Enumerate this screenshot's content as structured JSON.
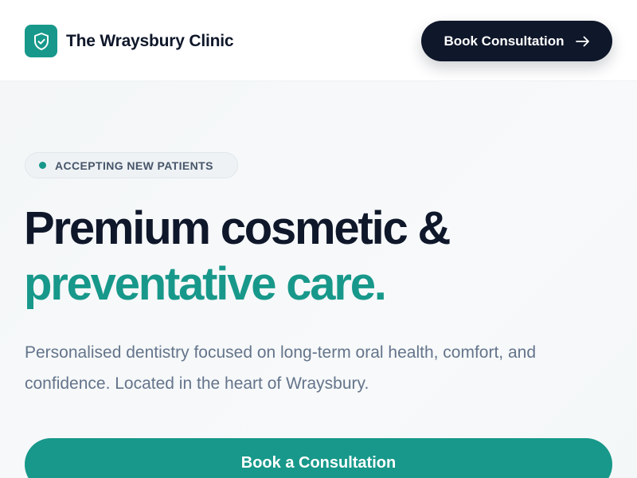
{
  "header": {
    "brand_name": "The Wraysbury Clinic",
    "logo_icon": "shield-check-icon",
    "cta_label": "Book Consultation",
    "cta_icon": "arrow-right-icon"
  },
  "hero": {
    "badge_text": "ACCEPTING NEW PATIENTS",
    "headline_line1": "Premium cosmetic &",
    "headline_line2": "preventative care.",
    "subtext": "Personalised dentistry focused on long-term oral health, comfort, and confidence. Located in the heart of Wraysbury.",
    "primary_cta_label": "Book a Consultation"
  },
  "colors": {
    "brand_teal": "#17988a",
    "navy": "#0f172a",
    "muted_text": "#64748b"
  }
}
